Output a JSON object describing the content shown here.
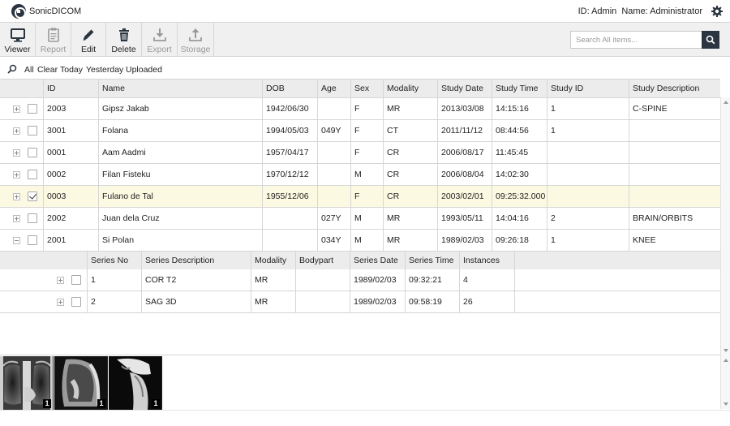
{
  "header": {
    "app_title": "SonicDICOM",
    "user_id_label": "ID: Admin",
    "user_name_label": "Name: Administrator"
  },
  "toolbar": {
    "buttons": [
      {
        "label": "Viewer",
        "icon": "monitor-icon",
        "enabled": true
      },
      {
        "label": "Report",
        "icon": "report-icon",
        "enabled": false
      },
      {
        "label": "Edit",
        "icon": "pencil-icon",
        "enabled": true
      },
      {
        "label": "Delete",
        "icon": "trash-icon",
        "enabled": true
      },
      {
        "label": "Export",
        "icon": "download-icon",
        "enabled": false
      },
      {
        "label": "Storage",
        "icon": "upload-icon",
        "enabled": false
      }
    ],
    "search_placeholder": "Search All items..."
  },
  "filters": [
    "All",
    "Clear",
    "Today",
    "Yesterday",
    "Uploaded"
  ],
  "studies": {
    "columns": [
      "ID",
      "Name",
      "DOB",
      "Age",
      "Sex",
      "Modality",
      "Study Date",
      "Study Time",
      "Study ID",
      "Study Description"
    ],
    "rows": [
      {
        "expander": "plus",
        "checked": false,
        "selected": false,
        "cells": [
          "2003",
          "Gipsz Jakab",
          "1942/06/30",
          "",
          "F",
          "MR",
          "2013/03/08",
          "14:15:16",
          "1",
          "C-SPINE"
        ]
      },
      {
        "expander": "plus",
        "checked": false,
        "selected": false,
        "cells": [
          "3001",
          "Folana",
          "1994/05/03",
          "049Y",
          "F",
          "CT",
          "2011/11/12",
          "08:44:56",
          "1",
          ""
        ]
      },
      {
        "expander": "plus",
        "checked": false,
        "selected": false,
        "cells": [
          "0001",
          "Aam Aadmi",
          "1957/04/17",
          "",
          "F",
          "CR",
          "2006/08/17",
          "11:45:45",
          "",
          ""
        ]
      },
      {
        "expander": "plus",
        "checked": false,
        "selected": false,
        "cells": [
          "0002",
          "Filan Fisteku",
          "1970/12/12",
          "",
          "M",
          "CR",
          "2006/08/04",
          "14:02:30",
          "",
          ""
        ]
      },
      {
        "expander": "plus",
        "checked": true,
        "selected": true,
        "cells": [
          "0003",
          "Fulano de Tal",
          "1955/12/06",
          "",
          "F",
          "CR",
          "2003/02/01",
          "09:25:32.000",
          "",
          ""
        ]
      },
      {
        "expander": "plus",
        "checked": false,
        "selected": false,
        "cells": [
          "2002",
          "Juan dela Cruz",
          "",
          "027Y",
          "M",
          "MR",
          "1993/05/11",
          "14:04:16",
          "2",
          "BRAIN/ORBITS"
        ]
      },
      {
        "expander": "minus",
        "checked": false,
        "selected": false,
        "cells": [
          "2001",
          "Si Polan",
          "",
          "034Y",
          "M",
          "MR",
          "1989/02/03",
          "09:26:18",
          "1",
          "KNEE"
        ]
      }
    ]
  },
  "series": {
    "columns": [
      "Series No",
      "Series Description",
      "Modality",
      "Bodypart",
      "Series Date",
      "Series Time",
      "Instances"
    ],
    "rows": [
      {
        "checked": false,
        "cells": [
          "1",
          "COR T2",
          "MR",
          "",
          "1989/02/03",
          "09:32:21",
          "4"
        ]
      },
      {
        "checked": false,
        "cells": [
          "2",
          "SAG 3D",
          "MR",
          "",
          "1989/02/03",
          "09:58:19",
          "26"
        ]
      }
    ]
  },
  "thumbnails": [
    {
      "kind": "chest-pa-xray",
      "count": "1"
    },
    {
      "kind": "chest-lateral-xray",
      "count": "1"
    },
    {
      "kind": "cervical-spine-xray",
      "count": "1"
    }
  ],
  "colors": {
    "header_dark": "#2b3542",
    "selected_row": "#fcf9e2",
    "toolbar_bg": "#f0f0f0",
    "grid_header_bg": "#ececec"
  }
}
